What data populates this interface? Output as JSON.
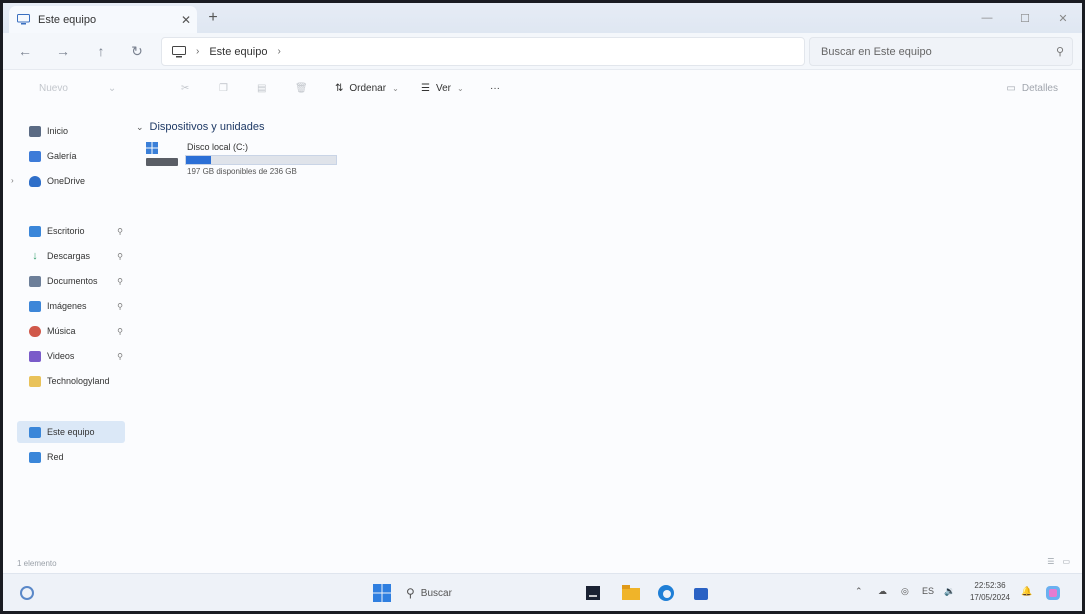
{
  "window": {
    "tab_title": "Este equipo",
    "new_tab": "+",
    "close_tab": "✕"
  },
  "nav": {
    "breadcrumb": "Este equipo",
    "search_placeholder": "Buscar en Este equipo"
  },
  "commands": {
    "new": "Nuevo",
    "sort": "Ordenar",
    "view": "Ver",
    "more": "···",
    "details": "Detalles"
  },
  "sidebar": {
    "items": [
      {
        "label": "Inicio",
        "icon": "home-icon",
        "color": "#5b6b84"
      },
      {
        "label": "Galería",
        "icon": "gallery-icon",
        "color": "#3d7bd8"
      },
      {
        "label": "OneDrive",
        "icon": "cloud-icon",
        "color": "#2f6fc9"
      },
      {
        "label": "Escritorio",
        "icon": "desktop-icon",
        "color": "#3a86d9"
      },
      {
        "label": "Descargas",
        "icon": "download-icon",
        "color": "#2f9f6a"
      },
      {
        "label": "Documentos",
        "icon": "documents-icon",
        "color": "#6d7f99"
      },
      {
        "label": "Imágenes",
        "icon": "pictures-icon",
        "color": "#3d86d8"
      },
      {
        "label": "Música",
        "icon": "music-icon",
        "color": "#d0584a"
      },
      {
        "label": "Videos",
        "icon": "videos-icon",
        "color": "#7a5bc9"
      },
      {
        "label": "Technologyland",
        "icon": "folder-icon",
        "color": "#e9c25a"
      },
      {
        "label": "Este equipo",
        "icon": "pc-icon",
        "color": "#3a86d9"
      },
      {
        "label": "Red",
        "icon": "network-icon",
        "color": "#3a86d9"
      }
    ]
  },
  "main": {
    "group_title": "Dispositivos y unidades",
    "drive": {
      "name": "Disco local (C:)",
      "space": "197 GB disponibles de 236 GB",
      "used_fraction": 0.165
    }
  },
  "status": {
    "count": "1 elemento"
  },
  "taskbar": {
    "search": "Buscar",
    "tray_lang": "ES",
    "time": "22:52:36",
    "date": "17/05/2024"
  },
  "colors": {
    "accent": "#2b6fd6",
    "selected": "#dbe8f7"
  }
}
